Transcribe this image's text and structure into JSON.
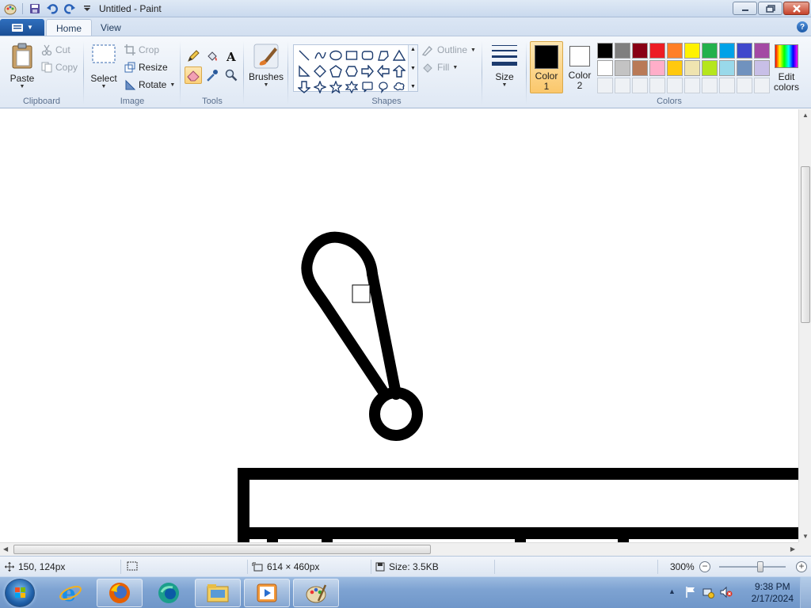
{
  "window": {
    "title": "Untitled - Paint"
  },
  "tabs": [
    {
      "label": "Home",
      "active": true
    },
    {
      "label": "View",
      "active": false
    }
  ],
  "ribbon": {
    "clipboard": {
      "group_label": "Clipboard",
      "paste_label": "Paste",
      "cut_label": "Cut",
      "copy_label": "Copy"
    },
    "image": {
      "group_label": "Image",
      "select_label": "Select",
      "crop_label": "Crop",
      "resize_label": "Resize",
      "rotate_label": "Rotate"
    },
    "tools": {
      "group_label": "Tools",
      "items": [
        "pencil",
        "fill",
        "text",
        "eraser",
        "color-picker",
        "magnifier"
      ],
      "selected": "eraser"
    },
    "brushes": {
      "label": "Brushes"
    },
    "shapes": {
      "group_label": "Shapes",
      "outline_label": "Outline",
      "fill_label": "Fill"
    },
    "size": {
      "label": "Size"
    },
    "colors": {
      "group_label": "Colors",
      "color1_label": "Color 1",
      "color2_label": "Color 2",
      "color1_line1": "Color",
      "color1_line2": "1",
      "color2_line1": "Color",
      "color2_line2": "2",
      "color1_value": "#000000",
      "color2_value": "#ffffff",
      "edit_line1": "Edit",
      "edit_line2": "colors",
      "palette_row1": [
        "#000000",
        "#7f7f7f",
        "#880015",
        "#ed1c24",
        "#ff7f27",
        "#fff200",
        "#22b14c",
        "#00a2e8",
        "#3f48cc",
        "#a349a4"
      ],
      "palette_row2": [
        "#ffffff",
        "#c3c3c3",
        "#b97a57",
        "#ffaec9",
        "#ffc90e",
        "#efe4b0",
        "#b5e61d",
        "#99d9ea",
        "#7092be",
        "#c8bfe7"
      ],
      "palette_row3_count": 10
    }
  },
  "status": {
    "cursor_pos": "150, 124px",
    "selection_size": "",
    "canvas_size": "614 × 460px",
    "file_size": "Size: 3.5KB",
    "zoom": "300%",
    "zoom_fraction": 0.62
  },
  "taskbar": {
    "apps": [
      "internet-explorer",
      "firefox",
      "edge",
      "file-explorer",
      "media-player",
      "paint"
    ],
    "time": "9:38 PM",
    "date": "2/17/2024"
  }
}
